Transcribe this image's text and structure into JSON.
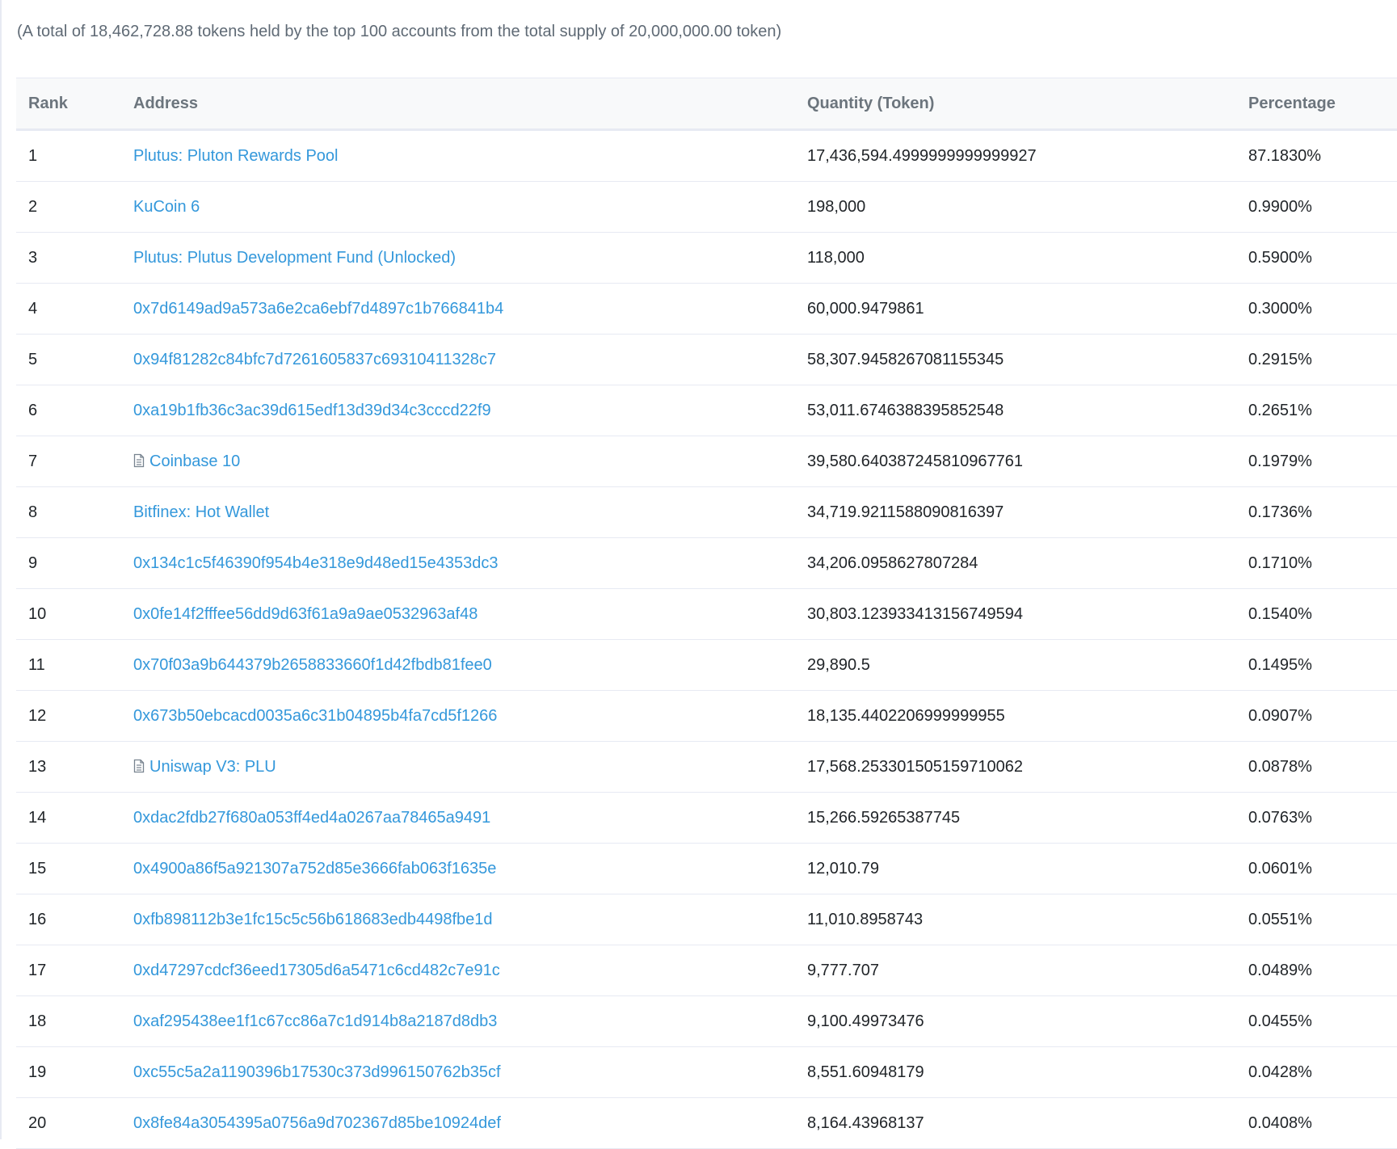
{
  "summary": "(A total of 18,462,728.88 tokens held by the top 100 accounts from the total supply of 20,000,000.00 token)",
  "table": {
    "headers": {
      "rank": "Rank",
      "address": "Address",
      "quantity": "Quantity (Token)",
      "percentage": "Percentage"
    },
    "rows": [
      {
        "rank": "1",
        "address": "Plutus: Pluton Rewards Pool",
        "contract": false,
        "quantity": "17,436,594.4999999999999927",
        "percentage": "87.1830%"
      },
      {
        "rank": "2",
        "address": "KuCoin 6",
        "contract": false,
        "quantity": "198,000",
        "percentage": "0.9900%"
      },
      {
        "rank": "3",
        "address": "Plutus: Plutus Development Fund (Unlocked)",
        "contract": false,
        "quantity": "118,000",
        "percentage": "0.5900%"
      },
      {
        "rank": "4",
        "address": "0x7d6149ad9a573a6e2ca6ebf7d4897c1b766841b4",
        "contract": false,
        "quantity": "60,000.9479861",
        "percentage": "0.3000%"
      },
      {
        "rank": "5",
        "address": "0x94f81282c84bfc7d7261605837c69310411328c7",
        "contract": false,
        "quantity": "58,307.9458267081155345",
        "percentage": "0.2915%"
      },
      {
        "rank": "6",
        "address": "0xa19b1fb36c3ac39d615edf13d39d34c3cccd22f9",
        "contract": false,
        "quantity": "53,011.6746388395852548",
        "percentage": "0.2651%"
      },
      {
        "rank": "7",
        "address": "Coinbase 10",
        "contract": true,
        "quantity": "39,580.640387245810967761",
        "percentage": "0.1979%"
      },
      {
        "rank": "8",
        "address": "Bitfinex: Hot Wallet",
        "contract": false,
        "quantity": "34,719.9211588090816397",
        "percentage": "0.1736%"
      },
      {
        "rank": "9",
        "address": "0x134c1c5f46390f954b4e318e9d48ed15e4353dc3",
        "contract": false,
        "quantity": "34,206.0958627807284",
        "percentage": "0.1710%"
      },
      {
        "rank": "10",
        "address": "0x0fe14f2fffee56dd9d63f61a9a9ae0532963af48",
        "contract": false,
        "quantity": "30,803.123933413156749594",
        "percentage": "0.1540%"
      },
      {
        "rank": "11",
        "address": "0x70f03a9b644379b2658833660f1d42fbdb81fee0",
        "contract": false,
        "quantity": "29,890.5",
        "percentage": "0.1495%"
      },
      {
        "rank": "12",
        "address": "0x673b50ebcacd0035a6c31b04895b4fa7cd5f1266",
        "contract": false,
        "quantity": "18,135.4402206999999955",
        "percentage": "0.0907%"
      },
      {
        "rank": "13",
        "address": "Uniswap V3: PLU",
        "contract": true,
        "quantity": "17,568.253301505159710062",
        "percentage": "0.0878%"
      },
      {
        "rank": "14",
        "address": "0xdac2fdb27f680a053ff4ed4a0267aa78465a9491",
        "contract": false,
        "quantity": "15,266.59265387745",
        "percentage": "0.0763%"
      },
      {
        "rank": "15",
        "address": "0x4900a86f5a921307a752d85e3666fab063f1635e",
        "contract": false,
        "quantity": "12,010.79",
        "percentage": "0.0601%"
      },
      {
        "rank": "16",
        "address": "0xfb898112b3e1fc15c5c56b618683edb4498fbe1d",
        "contract": false,
        "quantity": "11,010.8958743",
        "percentage": "0.0551%"
      },
      {
        "rank": "17",
        "address": "0xd47297cdcf36eed17305d6a5471c6cd482c7e91c",
        "contract": false,
        "quantity": "9,777.707",
        "percentage": "0.0489%"
      },
      {
        "rank": "18",
        "address": "0xaf295438ee1f1c67cc86a7c1d914b8a2187d8db3",
        "contract": false,
        "quantity": "9,100.49973476",
        "percentage": "0.0455%"
      },
      {
        "rank": "19",
        "address": "0xc55c5a2a1190396b17530c373d996150762b35cf",
        "contract": false,
        "quantity": "8,551.60948179",
        "percentage": "0.0428%"
      },
      {
        "rank": "20",
        "address": "0x8fe84a3054395a0756a9d702367d85be10924def",
        "contract": false,
        "quantity": "8,164.43968137",
        "percentage": "0.0408%"
      }
    ]
  },
  "colors": {
    "link": "#3498db",
    "header_text": "#6c757d",
    "muted_text": "#5f6a75",
    "border": "#e7eaf3"
  },
  "icons": {
    "contract": "file-text-icon"
  }
}
